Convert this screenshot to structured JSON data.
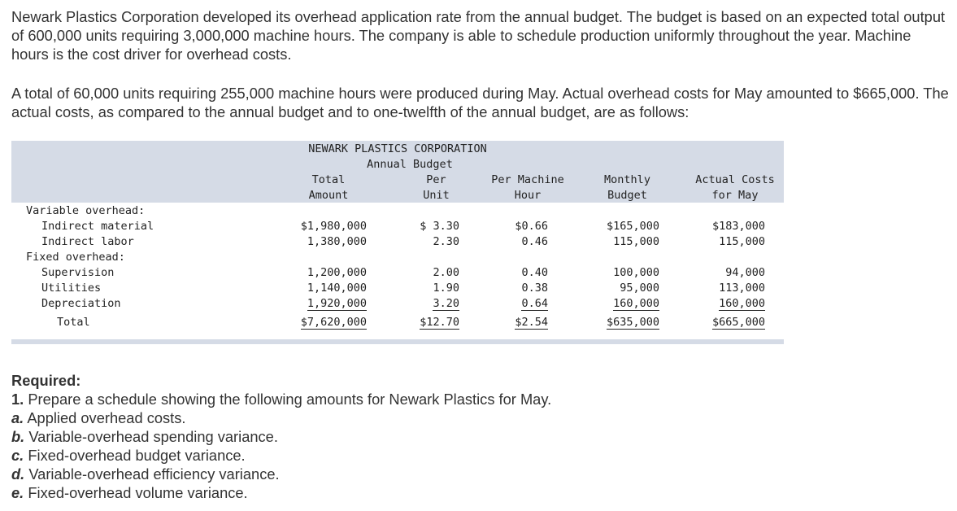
{
  "intro": {
    "paragraph1": "Newark Plastics Corporation developed its overhead application rate from the annual budget. The budget is based on an expected total output of 600,000 units requiring 3,000,000 machine hours. The company is able to schedule production uniformly throughout the year. Machine hours is the cost driver for overhead costs.",
    "paragraph2": "A total of 60,000 units requiring 255,000 machine hours were produced during May. Actual overhead costs for May amounted to $665,000. The actual costs, as compared to the annual budget and to one-twelfth of the annual budget, are as follows:"
  },
  "table": {
    "company": "NEWARK PLASTICS CORPORATION",
    "subtitle": "Annual Budget",
    "headers": {
      "total_1": "Total",
      "total_2": "Amount",
      "per_unit_1": "Per",
      "per_unit_2": "Unit",
      "per_mh_1": "Per Machine",
      "per_mh_2": "Hour",
      "monthly_1": "Monthly",
      "monthly_2": "Budget",
      "actual_1": "Actual Costs",
      "actual_2": "for May"
    },
    "sections": {
      "variable": "Variable overhead:",
      "fixed": "Fixed overhead:"
    },
    "rows": [
      {
        "label": "Indirect material",
        "total": "$1,980,000",
        "per_unit": "$ 3.30",
        "per_mh": "$0.66",
        "monthly": "$165,000",
        "actual": "$183,000"
      },
      {
        "label": "Indirect labor",
        "total": "1,380,000",
        "per_unit": "2.30",
        "per_mh": "0.46",
        "monthly": "115,000",
        "actual": "115,000"
      },
      {
        "label": "Supervision",
        "total": "1,200,000",
        "per_unit": "2.00",
        "per_mh": "0.40",
        "monthly": "100,000",
        "actual": "94,000"
      },
      {
        "label": "Utilities",
        "total": "1,140,000",
        "per_unit": "1.90",
        "per_mh": "0.38",
        "monthly": "95,000",
        "actual": "113,000"
      },
      {
        "label": "Depreciation",
        "total": "1,920,000",
        "per_unit": "3.20",
        "per_mh": "0.64",
        "monthly": "160,000",
        "actual": "160,000"
      }
    ],
    "total_row": {
      "label": "Total",
      "total": "$7,620,000",
      "per_unit": "$12.70",
      "per_mh": "$2.54",
      "monthly": "$635,000",
      "actual": "$665,000"
    }
  },
  "required": {
    "heading": "Required:",
    "item1_num": "1.",
    "item1_text": "Prepare a schedule showing the following amounts for Newark Plastics for May.",
    "items": [
      {
        "letter": "a.",
        "text": "Applied overhead costs."
      },
      {
        "letter": "b.",
        "text": "Variable-overhead spending variance."
      },
      {
        "letter": "c.",
        "text": "Fixed-overhead budget variance."
      },
      {
        "letter": "d.",
        "text": "Variable-overhead efficiency variance."
      },
      {
        "letter": "e.",
        "text": "Fixed-overhead volume variance."
      }
    ]
  }
}
